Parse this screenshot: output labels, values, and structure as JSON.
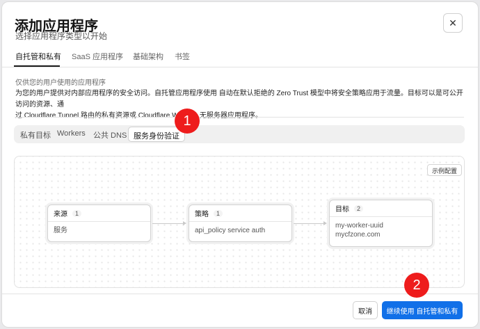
{
  "dialog": {
    "title": "添加应用程序",
    "subtitle": "选择应用程序类型以开始",
    "close_glyph": "✕"
  },
  "tabs": [
    {
      "label": "自托管和私有",
      "active": true
    },
    {
      "label": "SaaS 应用程序",
      "active": false
    },
    {
      "label": "基础架构",
      "active": false
    },
    {
      "label": "书签",
      "active": false
    }
  ],
  "description": {
    "heading": "仅供您的用户使用的应用程序",
    "line1": "为您的用户提供对内部应用程序的安全访问。自托管应用程序使用 自动在默认拒绝的 Zero Trust 模型中将安全策略应用于流量。目标可以是可公开访问的资源、通",
    "line2": "过 Cloudflare Tunnel 路由的私有资源或 Cloudflare Workers 无服务器应用程序。"
  },
  "segments": [
    {
      "label": "私有目标",
      "active": false
    },
    {
      "label": "Workers",
      "active": false
    },
    {
      "label": "公共 DNS",
      "active": false
    },
    {
      "label": "服务身份验证",
      "active": true
    }
  ],
  "diagram": {
    "sample_button": "示例配置",
    "nodes": [
      {
        "title": "来源",
        "count": "1",
        "items": [
          "服务"
        ]
      },
      {
        "title": "策略",
        "count": "1",
        "items": [
          "api_policy service auth"
        ]
      },
      {
        "title": "目标",
        "count": "2",
        "items": [
          "my-worker-uuid",
          "mycfzone.com"
        ]
      }
    ]
  },
  "footer": {
    "cancel_label": "取消",
    "continue_label": "继续使用 自托管和私有"
  },
  "markers": [
    "1",
    "2"
  ],
  "colors": {
    "primary_button": "#1170e8",
    "marker": "#ee1c1c"
  }
}
